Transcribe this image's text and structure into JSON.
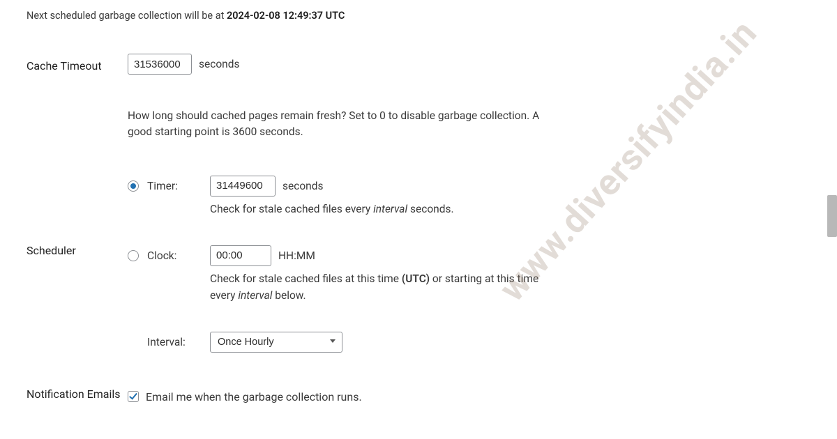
{
  "nextRun": {
    "prefix": "Next scheduled garbage collection will be at ",
    "datetime": "2024-02-08 12:49:37 UTC"
  },
  "cacheTimeout": {
    "label": "Cache Timeout",
    "value": "31536000",
    "unit": "seconds",
    "help": "How long should cached pages remain fresh? Set to 0 to disable garbage collection. A good starting point is 3600 seconds."
  },
  "scheduler": {
    "label": "Scheduler",
    "timer": {
      "label": "Timer:",
      "value": "31449600",
      "unit": "seconds",
      "hint_pre": "Check for stale cached files every ",
      "hint_em": "interval",
      "hint_post": " seconds."
    },
    "clock": {
      "label": "Clock:",
      "value": "00:00",
      "unit": "HH:MM",
      "hint_pre": "Check for stale cached files at this time ",
      "hint_utc": "(UTC)",
      "hint_mid": " or starting at this time every ",
      "hint_em": "interval",
      "hint_post": " below."
    },
    "interval": {
      "label": "Interval:",
      "selected": "Once Hourly"
    }
  },
  "notification": {
    "label": "Notification Emails",
    "checkbox_label": "Email me when the garbage collection runs."
  },
  "watermark": "www.diversifyindia.in"
}
